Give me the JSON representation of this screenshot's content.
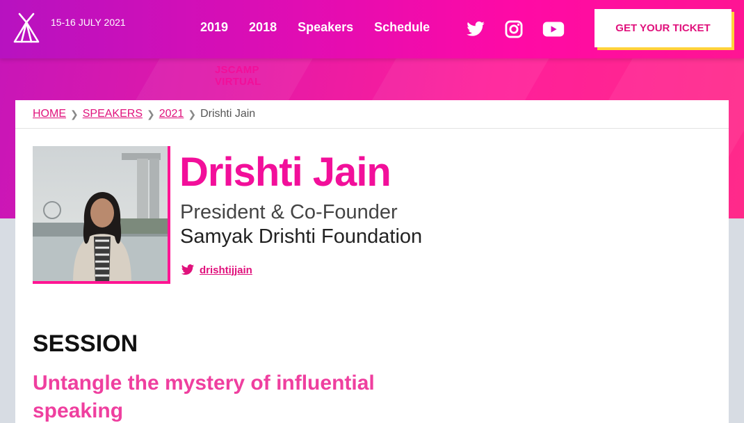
{
  "header": {
    "brand_name": "JSCAMP VIRTUAL",
    "brand_date": "15-16 JULY 2021",
    "nav": [
      "2019",
      "2018",
      "Speakers",
      "Schedule"
    ],
    "social": [
      "twitter-icon",
      "instagram-icon",
      "youtube-icon"
    ],
    "cta_label": "GET YOUR TICKET"
  },
  "breadcrumb": {
    "items": [
      "HOME",
      "SPEAKERS",
      "2021"
    ],
    "current": "Drishti Jain"
  },
  "speaker": {
    "name": "Drishti Jain",
    "role": "President & Co-Founder",
    "organization": "Samyak Drishti Foundation",
    "twitter": "drishtijjain"
  },
  "session": {
    "heading": "SESSION",
    "title": "Untangle the mystery of influential speaking"
  },
  "colors": {
    "accent": "#ff1493",
    "cta_shadow": "#ffd33a",
    "nav_start": "#b712c0"
  }
}
